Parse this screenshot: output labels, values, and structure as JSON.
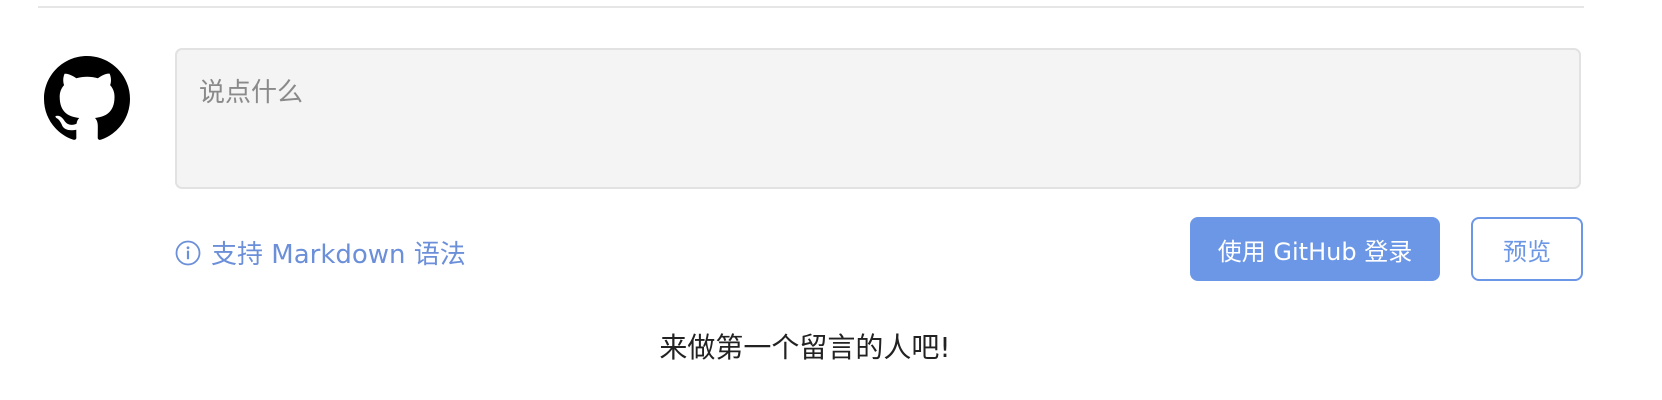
{
  "comment": {
    "placeholder": "说点什么",
    "value": ""
  },
  "hint": {
    "label": "支持 Markdown 语法",
    "icon": "info-icon"
  },
  "actions": {
    "login_label": "使用 GitHub 登录",
    "preview_label": "预览"
  },
  "status": {
    "empty_message": "来做第一个留言的人吧!"
  },
  "avatar": {
    "icon": "github-icon"
  },
  "colors": {
    "accent": "#6c97e6",
    "link": "#6b8fd8",
    "input_bg": "#f4f4f4",
    "text": "#222222"
  }
}
